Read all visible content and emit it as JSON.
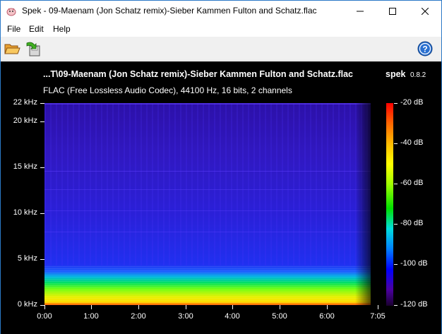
{
  "window": {
    "title": "Spek - 09-Maenam (Jon Schatz remix)-Sieber Kammen Fulton and Schatz.flac",
    "app_icon": "spek-app-icon",
    "controls": [
      "minimize-icon",
      "maximize-icon",
      "close-icon"
    ]
  },
  "menu": {
    "items": [
      {
        "label": "File"
      },
      {
        "label": "Edit"
      },
      {
        "label": "Help"
      }
    ]
  },
  "toolbar": {
    "buttons": [
      {
        "icon": "open-folder-icon"
      },
      {
        "icon": "save-icon"
      },
      {
        "icon": "help-icon"
      }
    ]
  },
  "spectrogram": {
    "file_title": "...T\\09-Maenam (Jon Schatz remix)-Sieber Kammen Fulton and Schatz.flac",
    "brand": "spek",
    "version": "0.8.2",
    "info": "FLAC (Free Lossless Audio Codec), 44100 Hz, 16 bits, 2 channels",
    "y_axis": {
      "min_khz": 0,
      "max_khz": 22,
      "ticks": [
        {
          "value": 22,
          "label": "22 kHz"
        },
        {
          "value": 20,
          "label": "20 kHz"
        },
        {
          "value": 15,
          "label": "15 kHz"
        },
        {
          "value": 10,
          "label": "10 kHz"
        },
        {
          "value": 5,
          "label": "5 kHz"
        },
        {
          "value": 0,
          "label": "0 kHz"
        }
      ]
    },
    "x_axis": {
      "min_s": 0,
      "max_s": 425,
      "ticks": [
        {
          "value": 0,
          "label": "0:00"
        },
        {
          "value": 60,
          "label": "1:00"
        },
        {
          "value": 120,
          "label": "2:00"
        },
        {
          "value": 180,
          "label": "3:00"
        },
        {
          "value": 240,
          "label": "4:00"
        },
        {
          "value": 300,
          "label": "5:00"
        },
        {
          "value": 360,
          "label": "6:00"
        },
        {
          "value": 425,
          "label": "7:05"
        }
      ]
    },
    "color_scale": {
      "min_db": -120,
      "max_db": -20,
      "ticks": [
        {
          "value": -20,
          "label": "-20 dB"
        },
        {
          "value": -40,
          "label": "-40 dB"
        },
        {
          "value": -60,
          "label": "-60 dB"
        },
        {
          "value": -80,
          "label": "-80 dB"
        },
        {
          "value": -100,
          "label": "-100 dB"
        },
        {
          "value": -120,
          "label": "-120 dB"
        }
      ]
    }
  }
}
